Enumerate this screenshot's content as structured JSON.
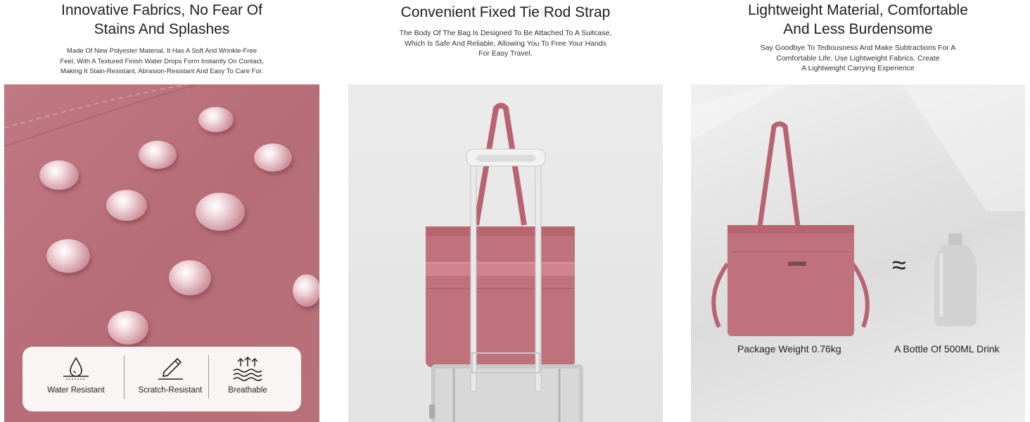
{
  "columns": [
    {
      "title_line1": "Innovative Fabrics,  No Fear Of",
      "title_line2": "Stains And Splashes",
      "desc_line1": "Made Of New Polyester Material, It Has A Soft And Wrinkle-Free",
      "desc_line2": "Feel, With A Textured Finish Water Drops Form Instantly On Contact,",
      "desc_line3": "Making It Stain-Resistant, Abrasion-Resistant And Easy To Care For.",
      "badges": [
        {
          "label": "Water Resistant",
          "icon": "water-drop-icon"
        },
        {
          "label": "Scratch-Resistant",
          "icon": "pen-scratch-icon"
        },
        {
          "label": "Breathable",
          "icon": "airflow-icon"
        }
      ]
    },
    {
      "title_line1": "Convenient Fixed Tie Rod Strap",
      "desc_line1": "The Body Of The Bag Is Designed To Be Attached To A Suitcase,",
      "desc_line2": "Which Is Safe And Reliable, Allowing You To Free Your Hands",
      "desc_line3": "For Easy Travel."
    },
    {
      "title_line1": "Lightweight Material, Comfortable",
      "title_line2": "And Less Burdensome",
      "desc_line1": "Say Goodbye To Tediousness And Make Subtractions For A",
      "desc_line2": "Comfortable Life. Use Lightweight Fabrics. Create",
      "desc_line3": "A Lightweight Carrying Experience",
      "caption_left": "Package Weight 0.76kg",
      "caption_right": "A Bottle Of 500ML Drink",
      "approx_symbol": "≈"
    }
  ],
  "colors": {
    "bag_pink": "#c0727c",
    "strap_pink": "#b86470",
    "fabric_pink": "#b86f79"
  }
}
